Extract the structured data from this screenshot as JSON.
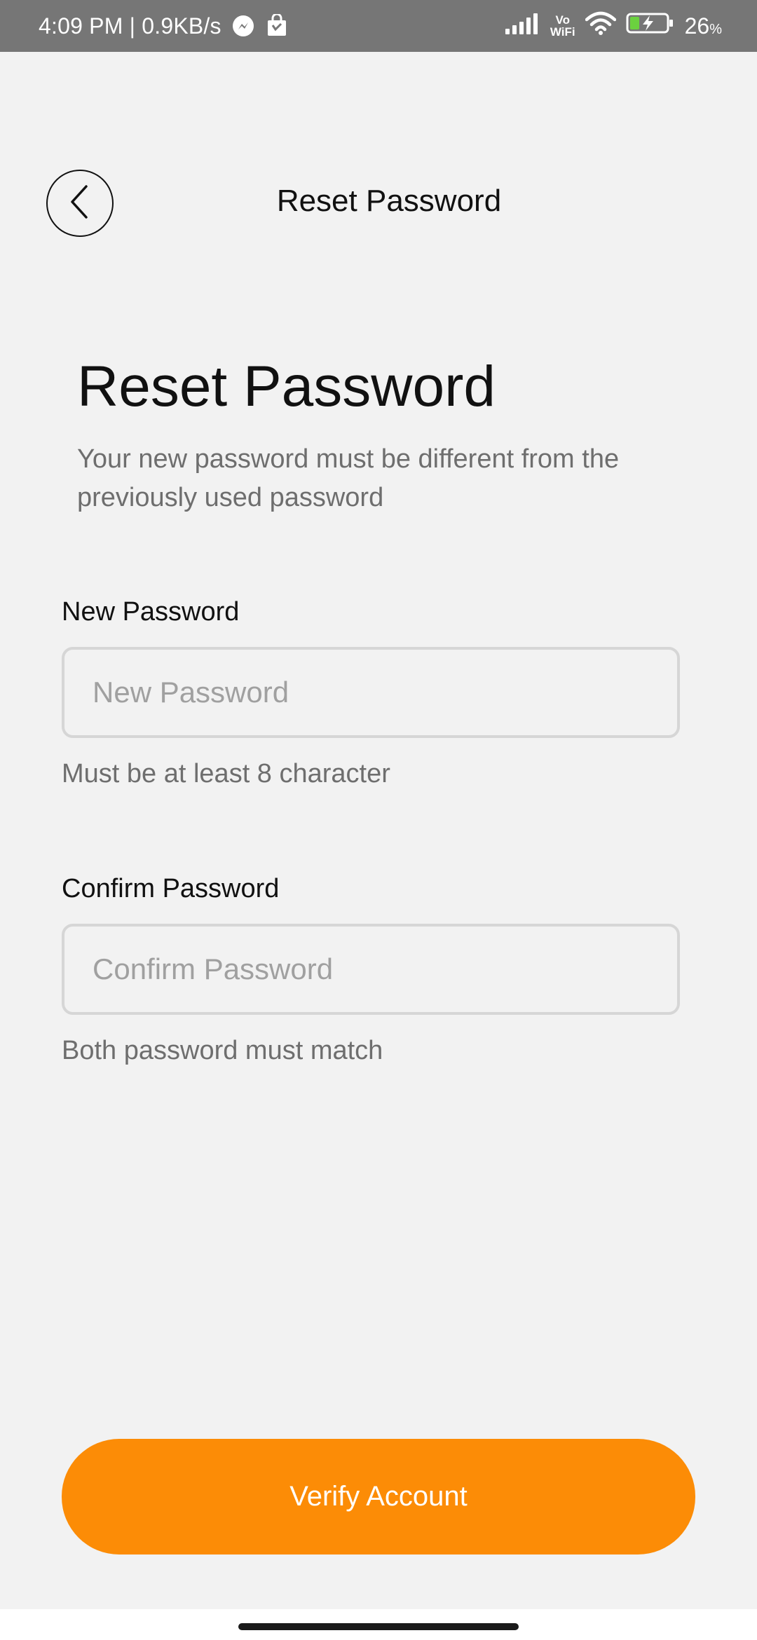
{
  "status_bar": {
    "time_speed": "4:09 PM | 0.9KB/s",
    "vowifi_top": "Vo",
    "vowifi_bottom": "WiFi",
    "battery_value": "26",
    "battery_unit": "%",
    "battery_level_percent": 26,
    "icons": [
      "messenger-icon",
      "shopping-bag-icon",
      "signal-icon",
      "wifi-icon",
      "battery-charging-icon"
    ]
  },
  "header": {
    "title": "Reset Password",
    "back_icon": "chevron-left-icon"
  },
  "main": {
    "title": "Reset Password",
    "subtitle": "Your new password must be different from the previously used password"
  },
  "form": {
    "new_password": {
      "label": "New Password",
      "placeholder": "New Password",
      "value": "",
      "hint": "Must be at least 8 character"
    },
    "confirm_password": {
      "label": "Confirm Password",
      "placeholder": "Confirm Password",
      "value": "",
      "hint": "Both password must match"
    }
  },
  "actions": {
    "verify_label": "Verify Account"
  },
  "colors": {
    "accent": "#fc8c06",
    "background": "#f2f2f2",
    "status_bar": "#767676",
    "battery_fill": "#6bd13f"
  }
}
